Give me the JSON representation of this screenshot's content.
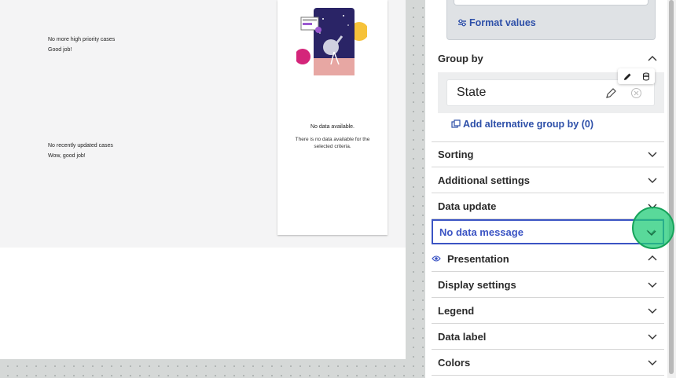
{
  "canvas": {
    "high_priority": {
      "title": "No more high priority cases",
      "subtitle": "Good job!"
    },
    "recently_updated": {
      "title": "No recently updated cases",
      "subtitle": "Wow, good job!"
    },
    "card": {
      "title": "No data available.",
      "text": "There is no data available for the selected criteria."
    }
  },
  "panel": {
    "format_values_label": "Format values",
    "group_by": {
      "label": "Group by",
      "value": "State",
      "add_alternative_label": "Add alternative group by (0)"
    },
    "sections": [
      {
        "label": "Sorting"
      },
      {
        "label": "Additional settings"
      },
      {
        "label": "Data update"
      },
      {
        "label": "No data message"
      },
      {
        "label": "Presentation"
      },
      {
        "label": "Display settings"
      },
      {
        "label": "Legend"
      },
      {
        "label": "Data label"
      },
      {
        "label": "Colors"
      }
    ]
  },
  "colors": {
    "accent": "#3b54c4",
    "link": "#2d4fa8",
    "cursor": "#22cc78"
  }
}
